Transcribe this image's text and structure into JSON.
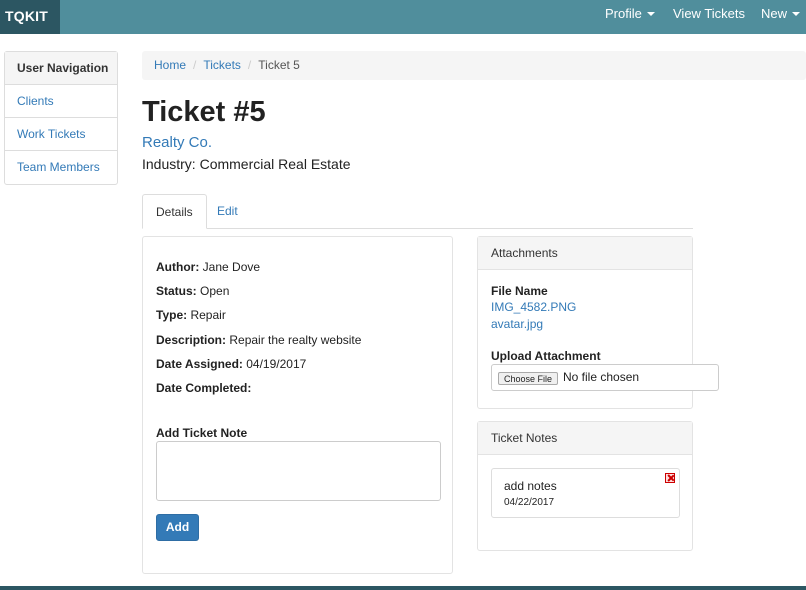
{
  "navbar": {
    "brand": "TQKIT",
    "profile": "Profile",
    "view_tickets": "View Tickets",
    "new": "New"
  },
  "sidenav": {
    "heading": "User Navigation",
    "items": [
      {
        "label": "Clients"
      },
      {
        "label": "Work Tickets"
      },
      {
        "label": "Team Members"
      }
    ]
  },
  "breadcrumb": {
    "home": "Home",
    "tickets": "Tickets",
    "current": "Ticket 5"
  },
  "ticket": {
    "title": "Ticket #5",
    "client": "Realty Co.",
    "industry": "Industry: Commercial Real Estate"
  },
  "tabs": {
    "details": "Details",
    "edit": "Edit"
  },
  "details": {
    "author_label": "Author:",
    "author": "Jane Dove",
    "status_label": "Status:",
    "status": "Open",
    "type_label": "Type:",
    "type": "Repair",
    "description_label": "Description:",
    "description": "Repair the realty website",
    "assigned_label": "Date Assigned:",
    "assigned": "04/19/2017",
    "completed_label": "Date Completed:",
    "completed": ""
  },
  "note_form": {
    "label": "Add Ticket Note",
    "value": "",
    "add_button": "Add"
  },
  "attachments": {
    "heading": "Attachments",
    "file_name_label": "File Name",
    "files": [
      "IMG_4582.PNG",
      "avatar.jpg"
    ],
    "upload_label": "Upload Attachment",
    "choose_button": "Choose File",
    "no_file": "No file chosen"
  },
  "notes": {
    "heading": "Ticket Notes",
    "items": [
      {
        "text": "add notes",
        "date": "04/22/2017"
      }
    ]
  },
  "colors": {
    "navbar": "#508e9c",
    "brand_bg": "#2c5662",
    "link": "#337ab7",
    "primary_button": "#337ab7"
  }
}
